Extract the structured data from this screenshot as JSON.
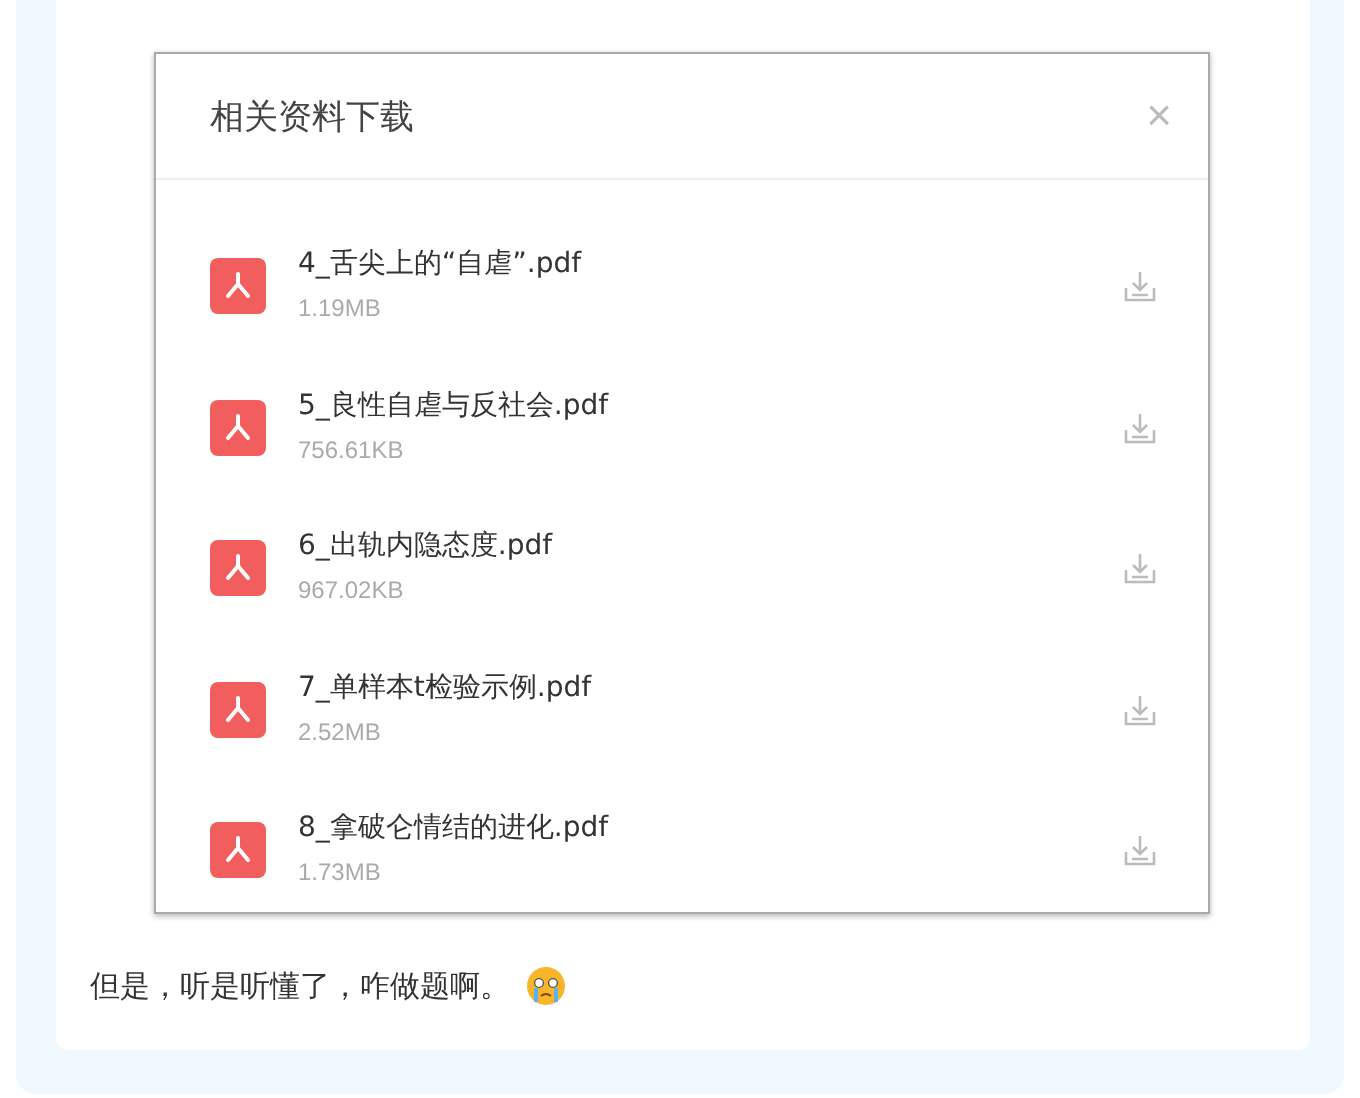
{
  "dialog": {
    "title": "相关资料下载",
    "close": "×"
  },
  "files": [
    {
      "name": "4_舌尖上的“自虐”.pdf",
      "size": "1.19MB"
    },
    {
      "name": "5_良性自虐与反社会.pdf",
      "size": "756.61KB"
    },
    {
      "name": "6_出轨内隐态度.pdf",
      "size": "967.02KB"
    },
    {
      "name": "7_单样本t检验示例.pdf",
      "size": "2.52MB"
    },
    {
      "name": "8_拿破仑情结的进化.pdf",
      "size": "1.73MB"
    }
  ],
  "message": "但是，听是听懂了，咋做题啊。"
}
